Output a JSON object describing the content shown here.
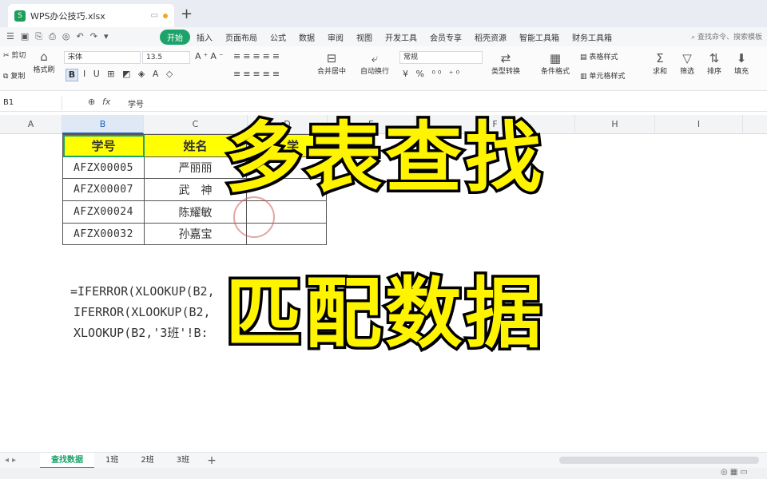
{
  "window": {
    "file_name": "WPS办公技巧.xlsx",
    "new_tab": "+"
  },
  "menu": {
    "items": [
      "开始",
      "插入",
      "页面布局",
      "公式",
      "数据",
      "审阅",
      "视图",
      "开发工具",
      "会员专享",
      "稻壳资源",
      "智能工具箱",
      "财务工具箱"
    ],
    "active_index": 0,
    "search_placeholder": "查找命令、搜索模板"
  },
  "ribbon": {
    "cut": "剪切",
    "copy": "复制",
    "format_painter": "格式刷",
    "font_name": "宋体",
    "font_size": "13.5",
    "merge": "合并居中",
    "wrap": "自动换行",
    "number_format": "常规",
    "type_convert": "类型转换",
    "conditional": "条件格式",
    "table_style": "表格样式",
    "cell_style": "单元格样式",
    "sum": "求和",
    "filter": "筛选",
    "sort": "排序",
    "fill": "填充"
  },
  "formula_bar": {
    "cell_ref": "B1",
    "fx": "fx",
    "content": "学号"
  },
  "columns": [
    "A",
    "B",
    "C",
    "D",
    "E",
    "F",
    "H",
    "I"
  ],
  "table": {
    "headers": [
      "学号",
      "姓名",
      "学"
    ],
    "rows": [
      [
        "AFZX00005",
        "严丽丽",
        ""
      ],
      [
        "AFZX00007",
        "武　神",
        ""
      ],
      [
        "AFZX00024",
        "陈耀敏",
        ""
      ],
      [
        "AFZX00032",
        "孙嘉宝",
        ""
      ]
    ]
  },
  "formulas": [
    "=IFERROR(XLOOKUP(B2,",
    " IFERROR(XLOOKUP(B2,",
    " XLOOKUP(B2,'3班'!B:"
  ],
  "overlay": {
    "line1": "多表查找",
    "line2": "匹配数据"
  },
  "sheets": {
    "tabs": [
      "查找数据",
      "1班",
      "2班",
      "3班"
    ],
    "active_index": 0,
    "add": "+"
  },
  "colors": {
    "accent": "#1ca36a",
    "header_fill": "#ffff00",
    "overlay_text": "#fff400"
  }
}
